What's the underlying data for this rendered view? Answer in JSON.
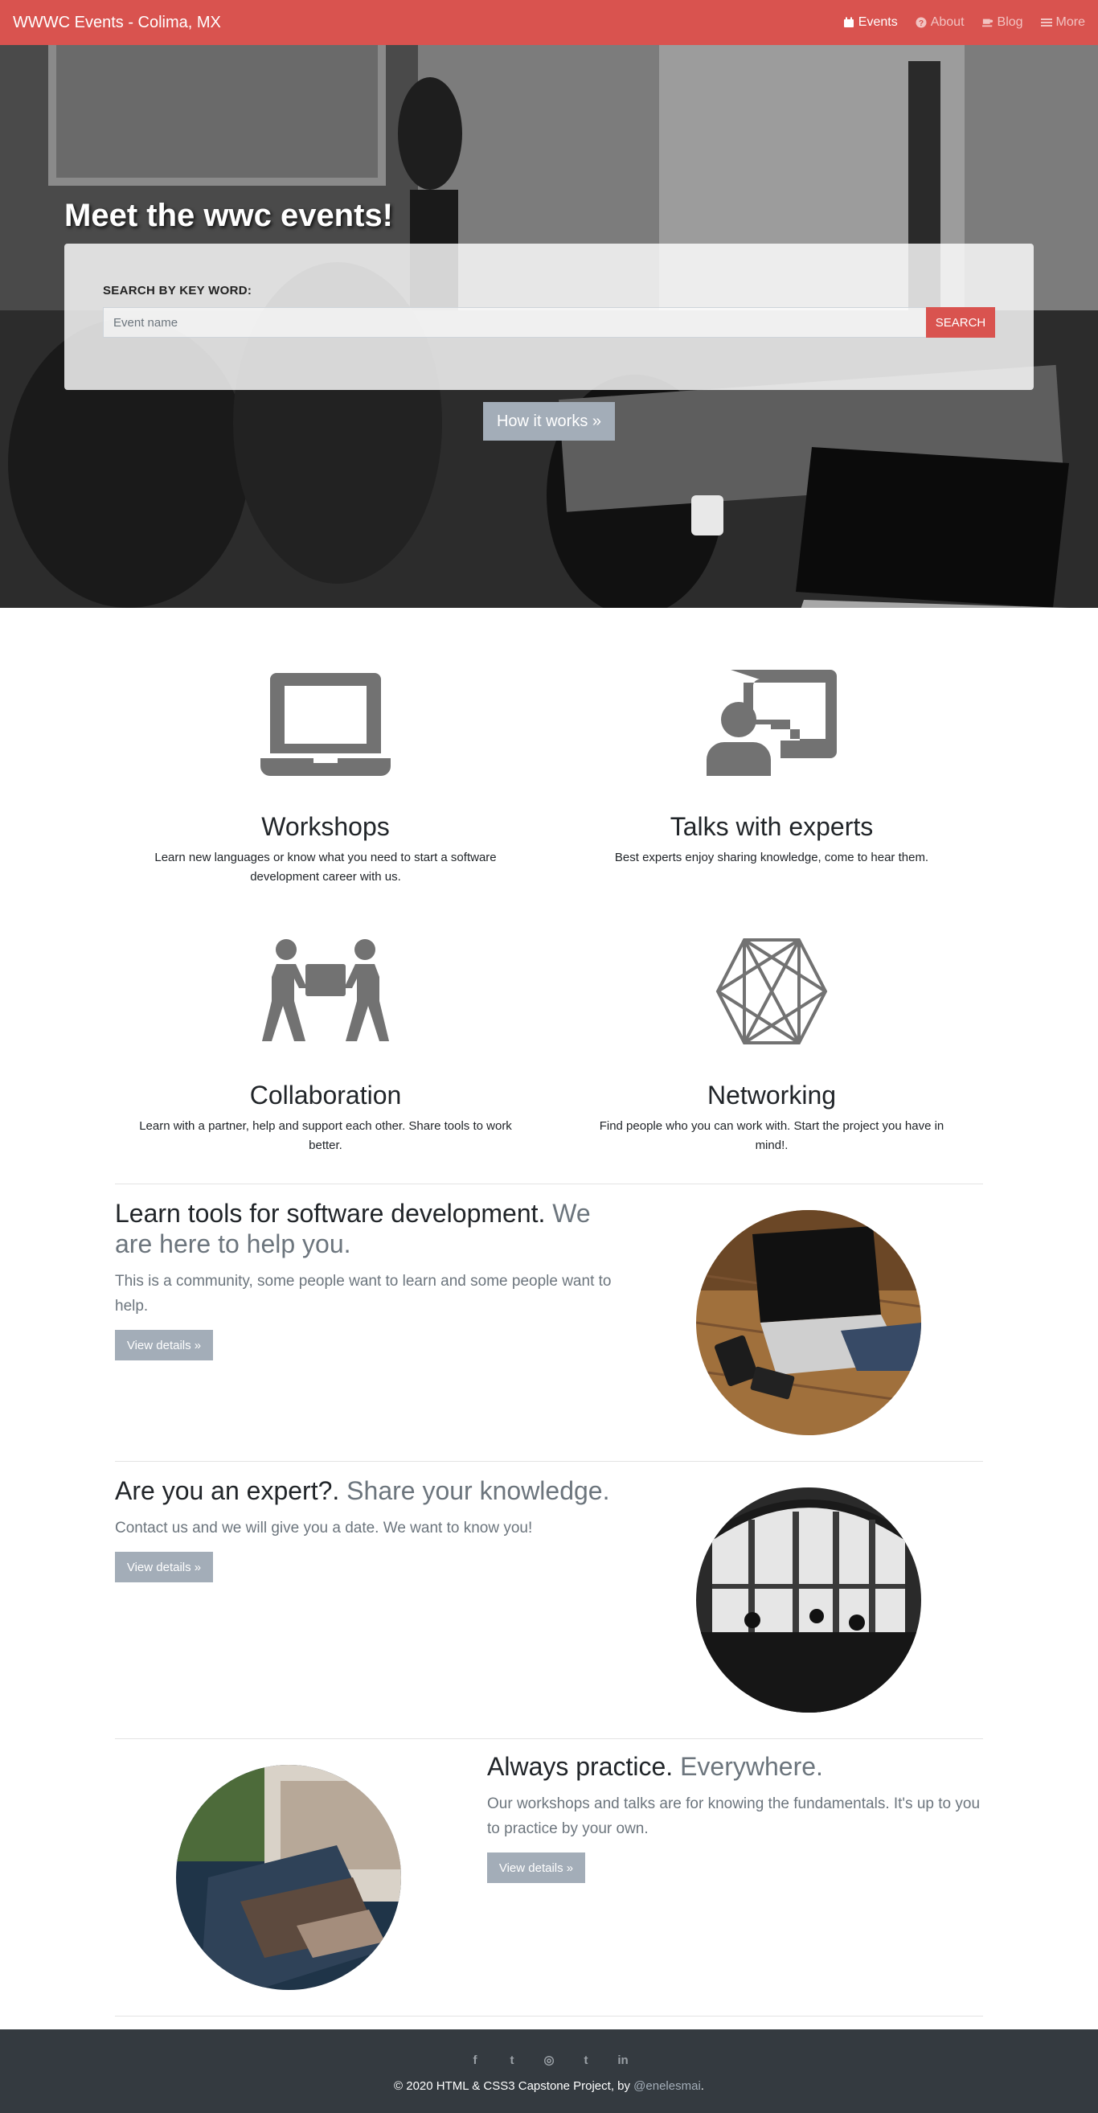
{
  "navbar": {
    "brand": "WWWC Events - Colima, MX",
    "links": [
      {
        "label": "Events",
        "icon": "calendar-icon"
      },
      {
        "label": "About",
        "icon": "question-circle-icon"
      },
      {
        "label": "Blog",
        "icon": "coffee-icon"
      },
      {
        "label": "More",
        "icon": "menu-icon"
      }
    ],
    "bg_color": "#d9534f"
  },
  "hero": {
    "title": "Meet the wwc events!",
    "search_label": "SEARCH BY KEY WORD:",
    "search_placeholder": "Event name",
    "search_button": "SEARCH",
    "how_button": "How it works »"
  },
  "features": [
    {
      "icon": "laptop-icon",
      "title": "Workshops",
      "text": "Learn new languages or know what you need to start a software development career with us."
    },
    {
      "icon": "chalkboard-teacher-icon",
      "title": "Talks with experts",
      "text": "Best experts enjoy sharing knowledge, come to hear them."
    },
    {
      "icon": "people-carry-icon",
      "title": "Collaboration",
      "text": "Learn with a partner, help and support each other. Share tools to work better."
    },
    {
      "icon": "network-hexagon-icon",
      "title": "Networking",
      "text": "Find people who you can work with. Start the project you have in mind!."
    }
  ],
  "marketing": [
    {
      "heading": "Learn tools for software development.",
      "heading_muted": "We are here to help you.",
      "text": "This is a community, some people want to learn and some people want to help.",
      "button": "View details »"
    },
    {
      "heading": "Are you an expert?.",
      "heading_muted": "Share your knowledge.",
      "text": "Contact us and we will give you a date. We want to know you!",
      "button": "View details »"
    },
    {
      "heading": "Always practice.",
      "heading_muted": "Everywhere.",
      "text": "Our workshops and talks are for knowing the fundamentals. It's up to you to practice by your own.",
      "button": "View details »"
    }
  ],
  "footer": {
    "social": [
      {
        "icon": "facebook-icon",
        "glyph": "f"
      },
      {
        "icon": "twitter-icon",
        "glyph": "t"
      },
      {
        "icon": "instagram-icon",
        "glyph": "◎"
      },
      {
        "icon": "tumblr-icon",
        "glyph": "t"
      },
      {
        "icon": "linkedin-icon",
        "glyph": "in"
      }
    ],
    "copyright": "© 2020 HTML & CSS3 Capstone Project, by ",
    "handle": "@enelesmai",
    "period": "."
  }
}
